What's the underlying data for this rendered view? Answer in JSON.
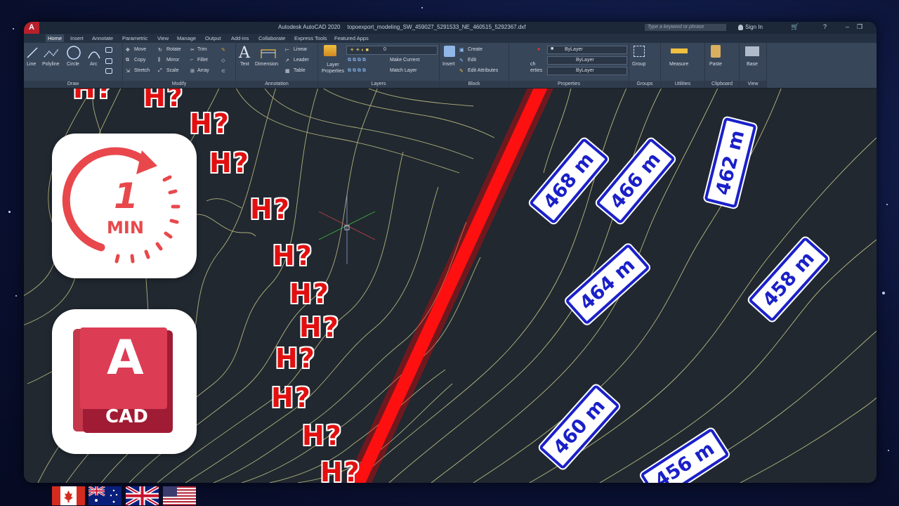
{
  "app": {
    "title_app": "Autodesk AutoCAD 2020",
    "title_file": "topoexport_modeling_SW_459027_5291533_NE_460515_5292367.dxf",
    "search_placeholder": "Type a keyword or phrase",
    "sign_in": "Sign In"
  },
  "tabs": [
    "Home",
    "Insert",
    "Annotate",
    "Parametric",
    "View",
    "Manage",
    "Output",
    "Add-ins",
    "Collaborate",
    "Express Tools",
    "Featured Apps"
  ],
  "ribbon": {
    "draw": {
      "title": "Draw",
      "line": "Line",
      "polyline": "Polyline",
      "circle": "Circle",
      "arc": "Arc"
    },
    "modify": {
      "title": "Modify",
      "move": "Move",
      "rotate": "Rotate",
      "trim": "Trim",
      "copy": "Copy",
      "mirror": "Mirror",
      "fillet": "Fillet",
      "stretch": "Stretch",
      "scale": "Scale",
      "array": "Array"
    },
    "annotation": {
      "title": "Annotation",
      "text": "Text",
      "dimension": "Dimension",
      "linear": "Linear",
      "leader": "Leader",
      "table": "Table"
    },
    "layers": {
      "title": "Layers",
      "layer_properties": "Layer Properties",
      "current_layer": "0",
      "make_current": "Make Current",
      "match_layer": "Match Layer"
    },
    "block": {
      "title": "Block",
      "insert": "Insert",
      "create": "Create",
      "edit": "Edit",
      "edit_attributes": "Edit Attributes"
    },
    "properties": {
      "title": "Properties",
      "match_partial": "ch",
      "properties_partial": "erties",
      "bylayer1": "ByLayer",
      "bylayer2": "ByLayer",
      "bylayer3": "ByLayer"
    },
    "groups": {
      "title": "Groups",
      "group": "Group"
    },
    "utilities": {
      "title": "Utilities",
      "measure": "Measure"
    },
    "clipboard": {
      "title": "Clipboard",
      "paste": "Paste"
    },
    "view": {
      "title": "View",
      "base": "Base"
    }
  },
  "overlay": {
    "hq_label": "H?",
    "elevations": [
      "468 m",
      "466 m",
      "462 m",
      "464 m",
      "458 m",
      "460 m",
      "456 m"
    ],
    "clock_number": "1",
    "clock_unit": "MIN",
    "cad_letter": "A",
    "cad_text": "CAD"
  },
  "flags": [
    "canada-flag",
    "australia-flag",
    "uk-flag",
    "usa-flag"
  ],
  "colors": {
    "contour": "#d8d890",
    "divider": "#ff1010",
    "label_blue": "#1a20c8",
    "hq_red": "#e11010",
    "autocad_red": "#c8283c"
  }
}
